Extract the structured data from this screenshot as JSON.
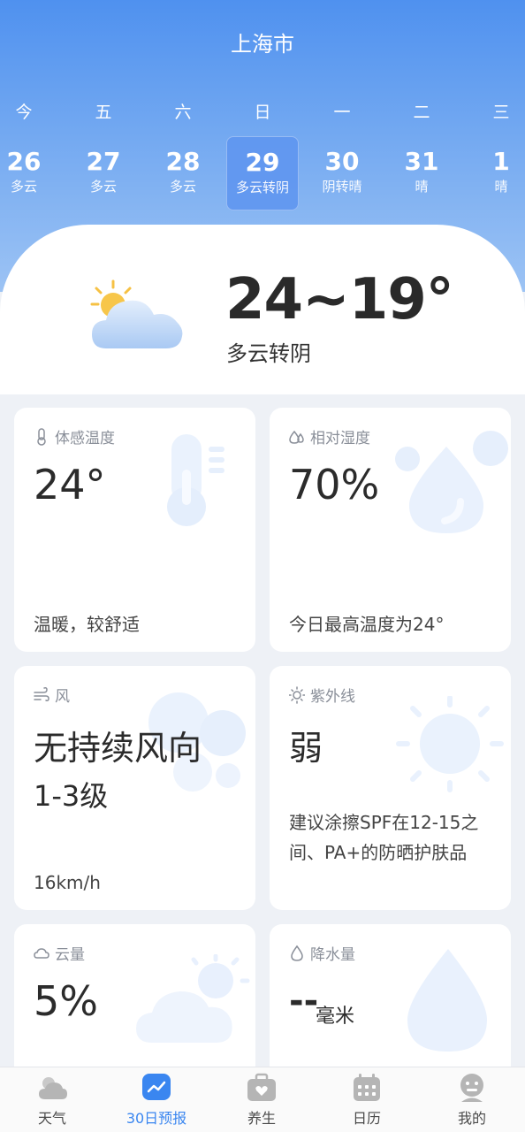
{
  "header": {
    "city": "上海市"
  },
  "week": [
    {
      "weekday": "今",
      "day": "26",
      "desc": "多云",
      "selected": false
    },
    {
      "weekday": "五",
      "day": "27",
      "desc": "多云",
      "selected": false
    },
    {
      "weekday": "六",
      "day": "28",
      "desc": "多云",
      "selected": false
    },
    {
      "weekday": "日",
      "day": "29",
      "desc": "多云转阴",
      "selected": true
    },
    {
      "weekday": "一",
      "day": "30",
      "desc": "阴转晴",
      "selected": false
    },
    {
      "weekday": "二",
      "day": "31",
      "desc": "晴",
      "selected": false
    },
    {
      "weekday": "三",
      "day": "1",
      "desc": "晴",
      "selected": false
    }
  ],
  "summary": {
    "temp_range": "24~19°",
    "condition": "多云转阴",
    "icon": "partly-cloudy-icon"
  },
  "cards": {
    "feels_like": {
      "label": "体感温度",
      "value": "24°",
      "note": "温暖，较舒适",
      "icon": "thermometer-icon"
    },
    "humidity": {
      "label": "相对湿度",
      "value": "70%",
      "note": "今日最高温度为24°",
      "icon": "droplets-icon"
    },
    "wind": {
      "label": "风",
      "direction": "无持续风向",
      "level": "1-3级",
      "speed": "16km/h",
      "icon": "wind-icon"
    },
    "uv": {
      "label": "紫外线",
      "value": "弱",
      "note": "建议涂擦SPF在12-15之间、PA+的防晒护肤品",
      "icon": "sun-icon"
    },
    "cloud": {
      "label": "云量",
      "value": "5%",
      "icon": "cloud-icon"
    },
    "precip": {
      "label": "降水量",
      "value": "--",
      "unit": "毫米",
      "icon": "raindrop-icon"
    }
  },
  "nav": {
    "items": [
      {
        "label": "天气",
        "icon": "weather-icon",
        "active": false
      },
      {
        "label": "30日预报",
        "icon": "trend-chart-icon",
        "active": true
      },
      {
        "label": "养生",
        "icon": "health-bag-icon",
        "active": false
      },
      {
        "label": "日历",
        "icon": "calendar-icon",
        "active": false
      },
      {
        "label": "我的",
        "icon": "profile-icon",
        "active": false
      }
    ]
  },
  "colors": {
    "accent": "#3a86f0",
    "header_top": "#4f91ef",
    "header_bottom": "#9cc3f4"
  }
}
